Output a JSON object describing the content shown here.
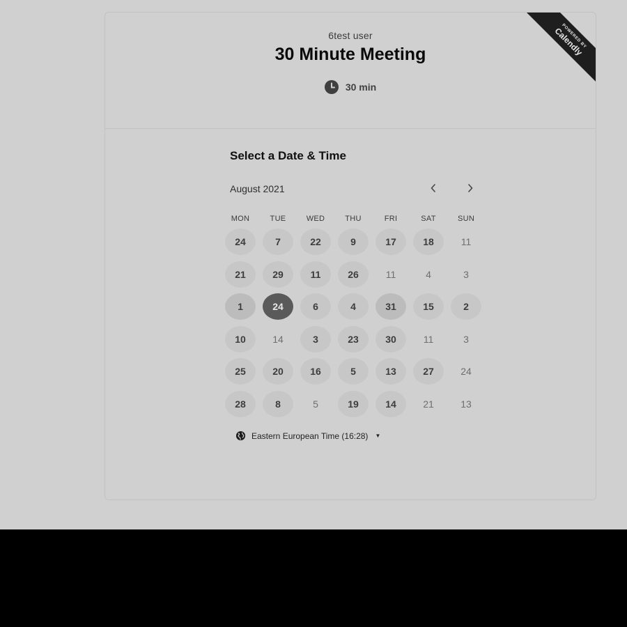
{
  "header": {
    "org_name": "6test user",
    "event_title": "30 Minute Meeting",
    "duration": "30 min"
  },
  "badge": {
    "line1": "POWERED BY",
    "line2": "Calendly"
  },
  "calendar": {
    "section_title": "Select a Date & Time",
    "month_label": "August 2021",
    "weekdays": [
      "MON",
      "TUE",
      "WED",
      "THU",
      "FRI",
      "SAT",
      "SUN"
    ],
    "selected": "24",
    "rows": [
      [
        {
          "d": "24",
          "a": true
        },
        {
          "d": "7",
          "a": true
        },
        {
          "d": "22",
          "a": true
        },
        {
          "d": "9",
          "a": true
        },
        {
          "d": "17",
          "a": true
        },
        {
          "d": "18",
          "a": true
        },
        {
          "d": "11",
          "a": false
        }
      ],
      [
        {
          "d": "21",
          "a": true
        },
        {
          "d": "29",
          "a": true
        },
        {
          "d": "11",
          "a": true
        },
        {
          "d": "26",
          "a": true
        },
        {
          "d": "11",
          "a": false
        },
        {
          "d": "4",
          "a": false
        },
        {
          "d": "3",
          "a": false
        }
      ],
      [
        {
          "d": "1",
          "a": true,
          "today": true
        },
        {
          "d": "24",
          "a": true,
          "sel": true
        },
        {
          "d": "6",
          "a": true
        },
        {
          "d": "4",
          "a": true
        },
        {
          "d": "31",
          "a": true,
          "today": true
        },
        {
          "d": "15",
          "a": true
        },
        {
          "d": "2",
          "a": true
        }
      ],
      [
        {
          "d": "10",
          "a": true
        },
        {
          "d": "14",
          "a": false
        },
        {
          "d": "3",
          "a": true
        },
        {
          "d": "23",
          "a": true
        },
        {
          "d": "30",
          "a": true
        },
        {
          "d": "11",
          "a": false
        },
        {
          "d": "3",
          "a": false
        }
      ],
      [
        {
          "d": "25",
          "a": true
        },
        {
          "d": "20",
          "a": true
        },
        {
          "d": "16",
          "a": true
        },
        {
          "d": "5",
          "a": true
        },
        {
          "d": "13",
          "a": true
        },
        {
          "d": "27",
          "a": true
        },
        {
          "d": "24",
          "a": false
        }
      ],
      [
        {
          "d": "28",
          "a": true
        },
        {
          "d": "8",
          "a": true
        },
        {
          "d": "5",
          "a": false
        },
        {
          "d": "19",
          "a": true
        },
        {
          "d": "14",
          "a": true
        },
        {
          "d": "21",
          "a": false
        },
        {
          "d": "13",
          "a": false
        }
      ]
    ]
  },
  "timezone": {
    "label": "Eastern European Time (16:28)"
  }
}
